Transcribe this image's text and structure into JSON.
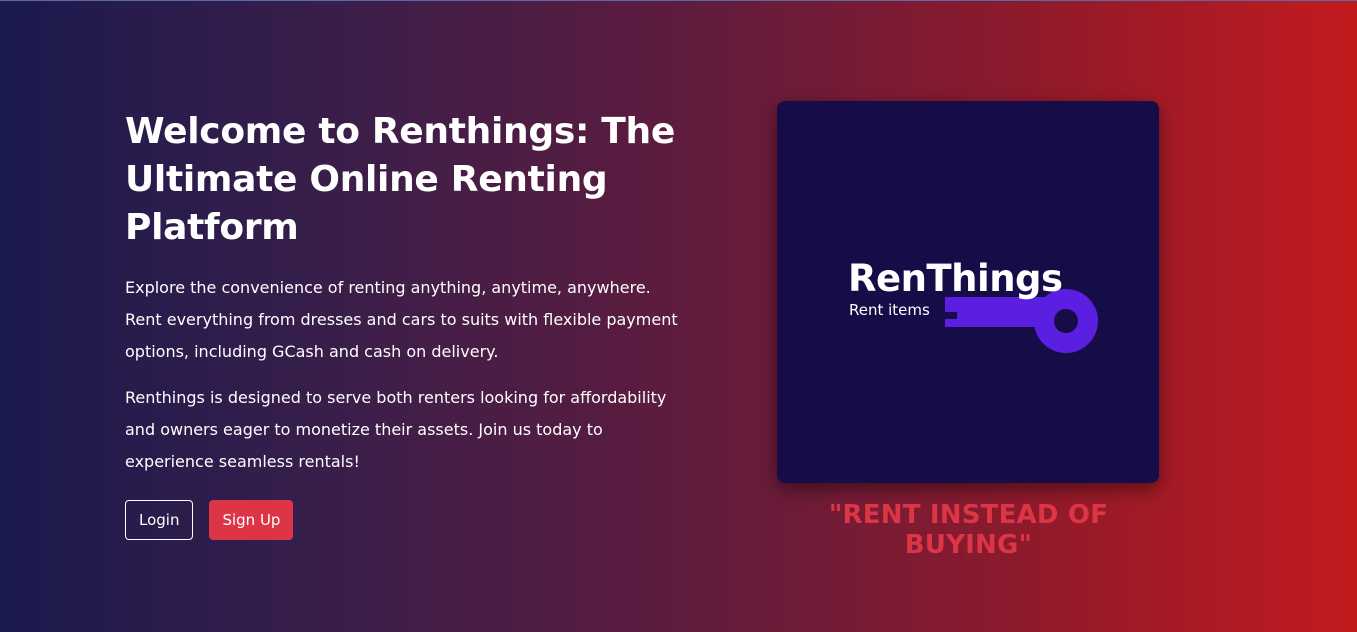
{
  "hero": {
    "title": "Welcome to Renthings: The Ultimate Online Renting Platform",
    "paragraph_1": "Explore the convenience of renting anything, anytime, anywhere. Rent everything from dresses and cars to suits with flexible payment options, including GCash and cash on delivery.",
    "paragraph_2": "Renthings is designed to serve both renters looking for affordability and owners eager to monetize their assets. Join us today to experience seamless rentals!"
  },
  "buttons": {
    "login_label": "Login",
    "signup_label": "Sign Up"
  },
  "logo": {
    "brand_name": "RenThings",
    "brand_subtitle": "Rent items",
    "icon": "key-icon",
    "card_color": "#160c47",
    "key_color": "#5a1fe0"
  },
  "tagline": "\"RENT INSTEAD OF BUYING\"",
  "colors": {
    "accent": "#dc3545",
    "gradient_start": "#1b1a4e",
    "gradient_end": "#c21b1e"
  }
}
